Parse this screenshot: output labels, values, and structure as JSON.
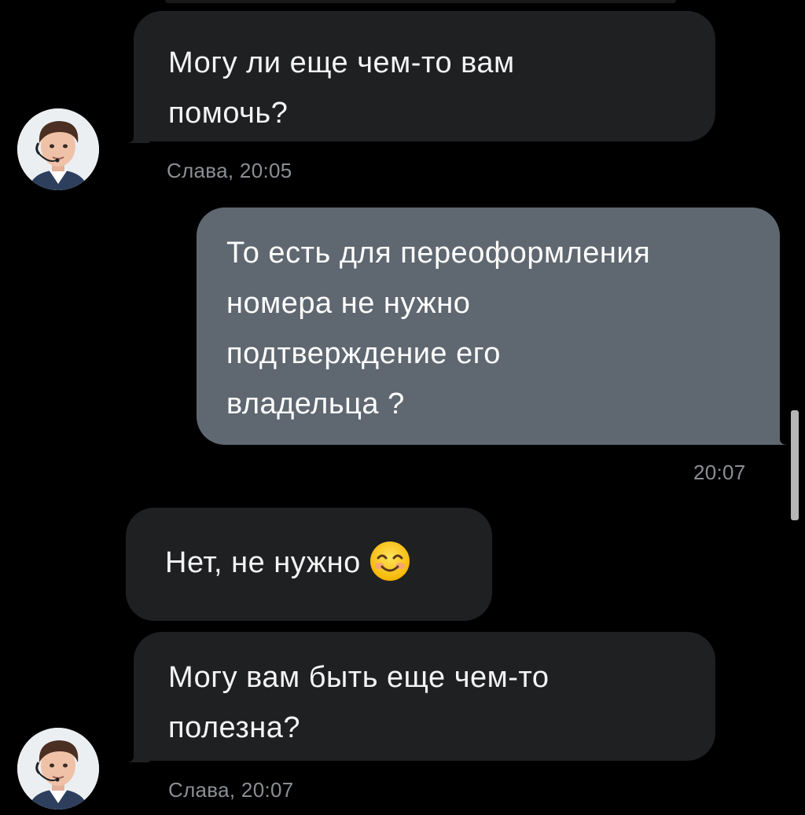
{
  "messages": [
    {
      "direction": "in",
      "lines": [
        "Могу ли еще чем-то вам",
        "помочь?"
      ],
      "meta": "Слава, 20:05"
    },
    {
      "direction": "out",
      "lines": [
        "То есть для переоформления",
        "номера не нужно",
        "подтверждение его",
        "владельца ?"
      ],
      "meta": "20:07"
    },
    {
      "direction": "in",
      "lines": [
        "Нет, не нужно"
      ],
      "emoji": "smiling-face-icon"
    },
    {
      "direction": "in",
      "lines": [
        "Могу вам быть еще чем-то",
        "полезна?"
      ],
      "meta": "Слава, 20:07"
    }
  ],
  "colors": {
    "background": "#000000",
    "incoming_bubble": "#1f2022",
    "outgoing_bubble": "#5f6770",
    "meta_text": "#8b8f94"
  }
}
